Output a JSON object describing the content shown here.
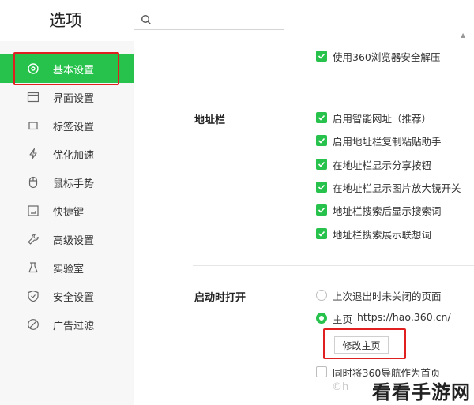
{
  "header": {
    "title": "选项",
    "search_placeholder": ""
  },
  "sidebar": {
    "items": [
      {
        "label": "基本设置",
        "icon": "settings-circle-icon",
        "active": true
      },
      {
        "label": "界面设置",
        "icon": "window-icon"
      },
      {
        "label": "标签设置",
        "icon": "tab-icon"
      },
      {
        "label": "优化加速",
        "icon": "lightning-icon"
      },
      {
        "label": "鼠标手势",
        "icon": "mouse-icon"
      },
      {
        "label": "快捷键",
        "icon": "keyboard-icon"
      },
      {
        "label": "高级设置",
        "icon": "wrench-icon"
      },
      {
        "label": "实验室",
        "icon": "flask-icon"
      },
      {
        "label": "安全设置",
        "icon": "shield-icon"
      },
      {
        "label": "广告过滤",
        "icon": "block-icon"
      }
    ]
  },
  "main": {
    "top_option": {
      "label": "使用360浏览器安全解压",
      "checked": true
    },
    "address_bar": {
      "label": "地址栏",
      "options": [
        {
          "label": "启用智能网址（推荐）",
          "checked": true
        },
        {
          "label": "启用地址栏复制粘贴助手",
          "checked": true
        },
        {
          "label": "在地址栏显示分享按钮",
          "checked": true
        },
        {
          "label": "在地址栏显示图片放大镜开关",
          "checked": true
        },
        {
          "label": "地址栏搜索后显示搜索词",
          "checked": true
        },
        {
          "label": "地址栏搜索展示联想词",
          "checked": true
        }
      ]
    },
    "startup": {
      "label": "启动时打开",
      "radio_last_session": "上次退出时未关闭的页面",
      "radio_homepage": "主页",
      "homepage_url": "https://hao.360.cn/",
      "edit_homepage_button": "修改主页",
      "also_nav_label": "同时将360导航作为首页"
    }
  },
  "watermark": {
    "text": "看看手游网",
    "faint_text": "©h"
  },
  "colors": {
    "accent": "#27c24c",
    "highlight_border": "#e02020",
    "sidebar_bg": "#f7f7f7"
  }
}
